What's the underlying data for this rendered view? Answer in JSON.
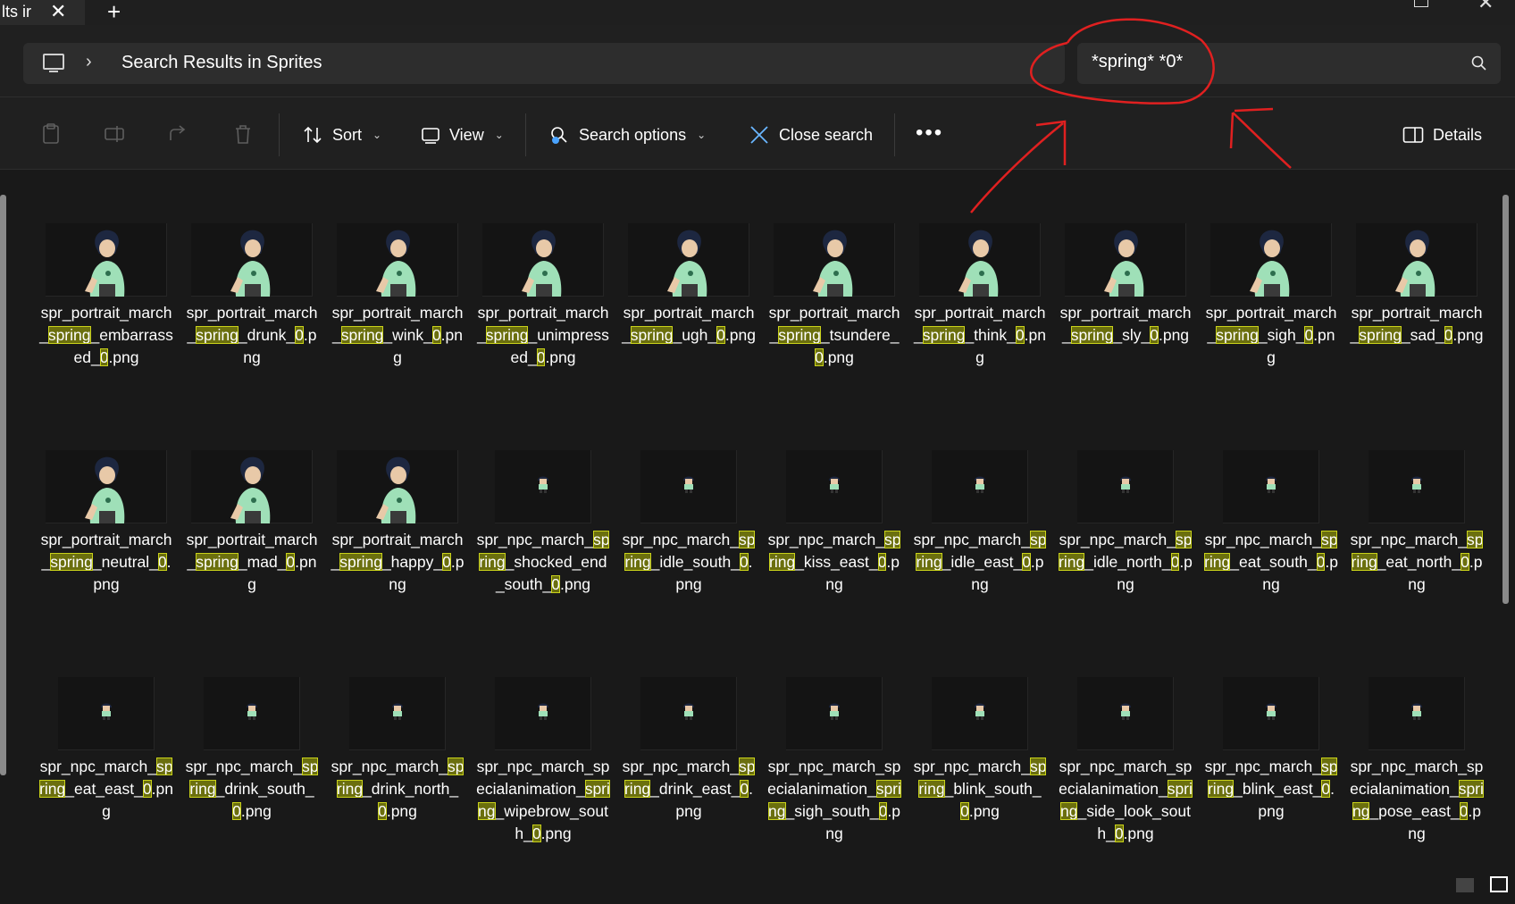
{
  "tab": {
    "title": "lts ir",
    "close": "✕",
    "new_tab": "+"
  },
  "window": {
    "close": "✕"
  },
  "address": {
    "chevron": "›",
    "breadcrumb": "Search Results in Sprites"
  },
  "search": {
    "value": "*spring* *0*"
  },
  "toolbar": {
    "sort_label": "Sort",
    "view_label": "View",
    "search_options_label": "Search options",
    "close_search_label": "Close search",
    "more_label": "•••",
    "details_label": "Details",
    "caret": "⌄"
  },
  "colors": {
    "highlight_fill": "#6b6f0e",
    "highlight_border": "#c9d21a",
    "annotation": "#e02020"
  },
  "files": [
    {
      "kind": "portrait",
      "parts": [
        "spr_portrait_march_",
        {
          "h": "spring"
        },
        "_embarrassed_",
        {
          "h": "0"
        },
        ".png"
      ]
    },
    {
      "kind": "portrait",
      "parts": [
        "spr_portrait_march_",
        {
          "h": "spring"
        },
        "_drunk_",
        {
          "h": "0"
        },
        ".png"
      ]
    },
    {
      "kind": "portrait",
      "parts": [
        "spr_portrait_march_",
        {
          "h": "spring"
        },
        "_wink_",
        {
          "h": "0"
        },
        ".png"
      ]
    },
    {
      "kind": "portrait",
      "parts": [
        "spr_portrait_march_",
        {
          "h": "spring"
        },
        "_unimpressed_",
        {
          "h": "0"
        },
        ".png"
      ]
    },
    {
      "kind": "portrait",
      "parts": [
        "spr_portrait_march_",
        {
          "h": "spring"
        },
        "_ugh_",
        {
          "h": "0"
        },
        ".png"
      ]
    },
    {
      "kind": "portrait",
      "parts": [
        "spr_portrait_march_",
        {
          "h": "spring"
        },
        "_tsundere_",
        {
          "h": "0"
        },
        ".png"
      ]
    },
    {
      "kind": "portrait",
      "parts": [
        "spr_portrait_march_",
        {
          "h": "spring"
        },
        "_think_",
        {
          "h": "0"
        },
        ".png"
      ]
    },
    {
      "kind": "portrait",
      "parts": [
        "spr_portrait_march_",
        {
          "h": "spring"
        },
        "_sly_",
        {
          "h": "0"
        },
        ".png"
      ]
    },
    {
      "kind": "portrait",
      "parts": [
        "spr_portrait_march_",
        {
          "h": "spring"
        },
        "_sigh_",
        {
          "h": "0"
        },
        ".png"
      ]
    },
    {
      "kind": "portrait",
      "parts": [
        "spr_portrait_march_",
        {
          "h": "spring"
        },
        "_sad_",
        {
          "h": "0"
        },
        ".png"
      ]
    },
    {
      "kind": "portrait",
      "parts": [
        "spr_portrait_march_",
        {
          "h": "spring"
        },
        "_neutral_",
        {
          "h": "0"
        },
        ".png"
      ]
    },
    {
      "kind": "portrait",
      "parts": [
        "spr_portrait_march_",
        {
          "h": "spring"
        },
        "_mad_",
        {
          "h": "0"
        },
        ".png"
      ]
    },
    {
      "kind": "portrait",
      "parts": [
        "spr_portrait_march_",
        {
          "h": "spring"
        },
        "_happy_",
        {
          "h": "0"
        },
        ".png"
      ]
    },
    {
      "kind": "npc",
      "parts": [
        "spr_npc_march_",
        {
          "h": "spring"
        },
        "_shocked_end_south_",
        {
          "h": "0"
        },
        ".png"
      ]
    },
    {
      "kind": "npc",
      "parts": [
        "spr_npc_march_",
        {
          "h": "spring"
        },
        "_idle_south_",
        {
          "h": "0"
        },
        ".png"
      ]
    },
    {
      "kind": "npc",
      "parts": [
        "spr_npc_march_",
        {
          "h": "spring"
        },
        "_kiss_east_",
        {
          "h": "0"
        },
        ".png"
      ]
    },
    {
      "kind": "npc",
      "parts": [
        "spr_npc_march_",
        {
          "h": "spring"
        },
        "_idle_east_",
        {
          "h": "0"
        },
        ".png"
      ]
    },
    {
      "kind": "npc",
      "parts": [
        "spr_npc_march_",
        {
          "h": "spring"
        },
        "_idle_north_",
        {
          "h": "0"
        },
        ".png"
      ]
    },
    {
      "kind": "npc",
      "parts": [
        "spr_npc_march_",
        {
          "h": "spring"
        },
        "_eat_south_",
        {
          "h": "0"
        },
        ".png"
      ]
    },
    {
      "kind": "npc",
      "parts": [
        "spr_npc_march_",
        {
          "h": "spring"
        },
        "_eat_north_",
        {
          "h": "0"
        },
        ".png"
      ]
    },
    {
      "kind": "npc",
      "parts": [
        "spr_npc_march_",
        {
          "h": "spring"
        },
        "_eat_east_",
        {
          "h": "0"
        },
        ".png"
      ]
    },
    {
      "kind": "npc",
      "parts": [
        "spr_npc_march_",
        {
          "h": "spring"
        },
        "_drink_south_",
        {
          "h": "0"
        },
        ".png"
      ]
    },
    {
      "kind": "npc",
      "parts": [
        "spr_npc_march_",
        {
          "h": "spring"
        },
        "_drink_north_",
        {
          "h": "0"
        },
        ".png"
      ]
    },
    {
      "kind": "npc",
      "parts": [
        "spr_npc_march_specialanimation_",
        {
          "h": "spring"
        },
        "_wipebrow_south_",
        {
          "h": "0"
        },
        ".png"
      ]
    },
    {
      "kind": "npc",
      "parts": [
        "spr_npc_march_",
        {
          "h": "spring"
        },
        "_drink_east_",
        {
          "h": "0"
        },
        ".png"
      ]
    },
    {
      "kind": "npc",
      "parts": [
        "spr_npc_march_specialanimation_",
        {
          "h": "spring"
        },
        "_sigh_south_",
        {
          "h": "0"
        },
        ".png"
      ]
    },
    {
      "kind": "npc",
      "parts": [
        "spr_npc_march_",
        {
          "h": "spring"
        },
        "_blink_south_",
        {
          "h": "0"
        },
        ".png"
      ]
    },
    {
      "kind": "npc",
      "parts": [
        "spr_npc_march_specialanimation_",
        {
          "h": "spring"
        },
        "_side_look_south_",
        {
          "h": "0"
        },
        ".png"
      ]
    },
    {
      "kind": "npc",
      "parts": [
        "spr_npc_march_",
        {
          "h": "spring"
        },
        "_blink_east_",
        {
          "h": "0"
        },
        ".png"
      ]
    },
    {
      "kind": "npc",
      "parts": [
        "spr_npc_march_specialanimation_",
        {
          "h": "spring"
        },
        "_pose_east_",
        {
          "h": "0"
        },
        ".png"
      ]
    }
  ]
}
